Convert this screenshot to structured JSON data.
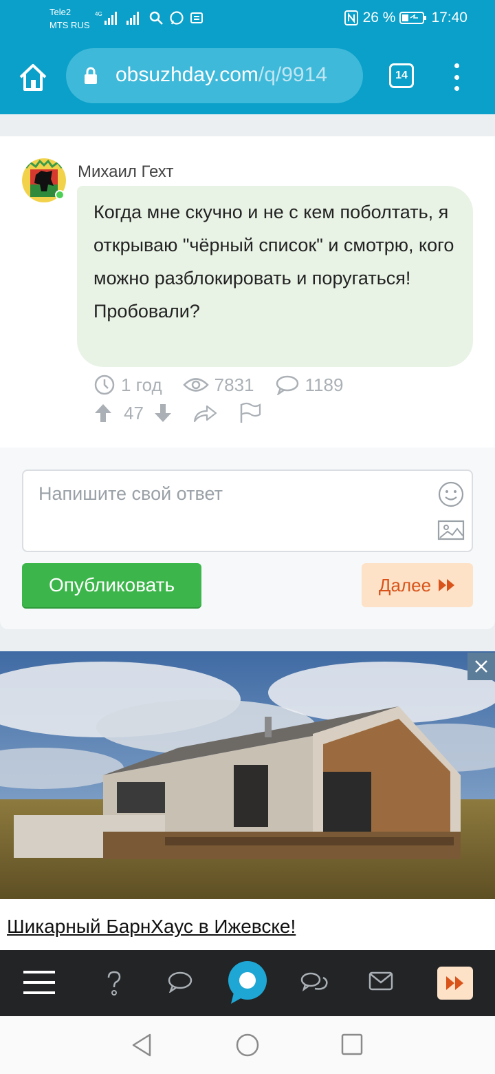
{
  "status_bar": {
    "carrier1": "Tele2",
    "carrier2": "MTS RUS",
    "network_label": "4G",
    "battery_percent": "26 %",
    "time": "17:40"
  },
  "browser": {
    "url_domain": "obsuzhday.com",
    "url_path": "/q/9914",
    "tab_count": "14"
  },
  "post": {
    "author": "Михаил Гехт",
    "text": "Когда мне скучно и не с кем поболтать, я открываю \"чёрный список\" и смотрю, кого можно разблокировать и поругаться! Пробовали?",
    "time_ago": "1 год",
    "views": "7831",
    "comments": "1189",
    "votes": "47"
  },
  "reply": {
    "placeholder": "Напишите свой ответ",
    "publish_label": "Опубликовать",
    "next_label": "Далее"
  },
  "ad": {
    "title": "Шикарный БарнХаус в Ижевске!"
  },
  "colors": {
    "brand": "#0aa0c9",
    "publish": "#3cb64a",
    "next_bg": "#fde2c8",
    "next_text": "#d9541a",
    "bubble": "#e8f3e5"
  }
}
